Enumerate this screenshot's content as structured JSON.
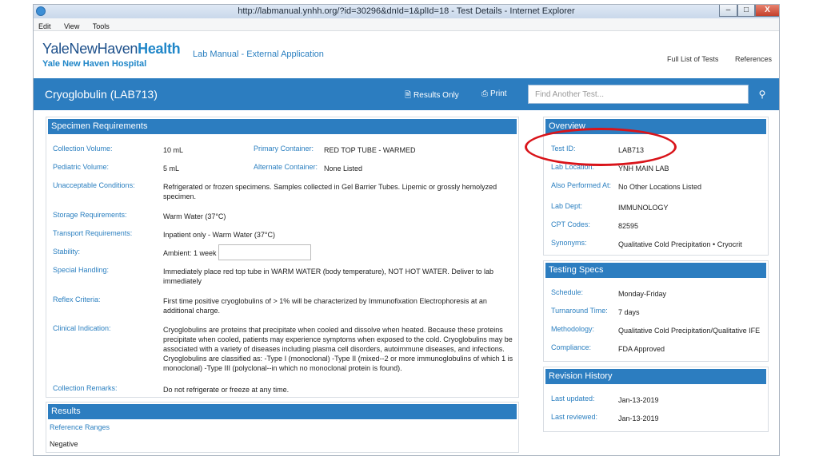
{
  "window": {
    "title": "http://labmanual.ynhh.org/?id=30296&dnId=1&plId=18 - Test Details - Internet Explorer",
    "min_label": "–",
    "max_label": "□",
    "close_label": "X"
  },
  "menu": [
    "Edit",
    "View",
    "Tools"
  ],
  "header": {
    "logo_main": "YaleNewHaven",
    "logo_accent": "Health",
    "logo_sub": "Yale New Haven Hospital",
    "app_name": "Lab Manual - External Application",
    "links": [
      "Full List of Tests",
      "References"
    ]
  },
  "bar": {
    "test_title": "Cryoglobulin (LAB713)",
    "results_only": "Results Only",
    "print": "Print",
    "search_placeholder": "Find Another Test..."
  },
  "specimen": {
    "heading": "Specimen Requirements",
    "collection_volume_label": "Collection Volume:",
    "collection_volume": "10  mL",
    "primary_container_label": "Primary Container:",
    "primary_container": "RED TOP TUBE - WARMED",
    "pediatric_volume_label": "Pediatric Volume:",
    "pediatric_volume": "5  mL",
    "alternate_container_label": "Alternate Container:",
    "alternate_container": "None Listed",
    "unacceptable_label": "Unacceptable Conditions:",
    "unacceptable": "Refrigerated or frozen specimens. Samples collected in Gel Barrier Tubes. Lipemic or grossly hemolyzed specimen.",
    "storage_label": "Storage Requirements:",
    "storage": "Warm Water (37°C)",
    "transport_label": "Transport Requirements:",
    "transport": "Inpatient only - Warm Water (37°C)",
    "stability_label": "Stability:",
    "stability": "Ambient: 1 week",
    "special_label": "Special Handling:",
    "special": "Immediately place red top tube in WARM WATER (body temperature), NOT HOT WATER. Deliver to lab immediately",
    "reflex_label": "Reflex Criteria:",
    "reflex": "First time positive cryoglobulins of > 1% will be characterized by Immunofixation Electrophoresis at an additional charge.",
    "clinical_label": "Clinical Indication:",
    "clinical": "Cryoglobulins are proteins that precipitate when cooled and dissolve when heated. Because these proteins precipitate when cooled, patients may experience symptoms when exposed to the cold. Cryoglobulins may be associated with a variety of diseases including plasma cell disorders, autoimmune diseases, and infections. Cryoglobulins are classified as: -Type I (monoclonal) -Type II (mixed--2 or more immunoglobulins of which 1 is monoclonal) -Type III (polyclonal--in which no monoclonal protein is found).",
    "remarks_label": "Collection Remarks:",
    "remarks": "Do not refrigerate or freeze at any time."
  },
  "results": {
    "heading": "Results",
    "reference_label": "Reference Ranges",
    "reference_value": "Negative"
  },
  "overview": {
    "heading": "Overview",
    "test_id_label": "Test ID:",
    "test_id": "LAB713",
    "lab_location_label": "Lab Location:",
    "lab_location": "YNH MAIN LAB",
    "also_performed_label": "Also Performed At:",
    "also_performed": "No Other Locations Listed",
    "lab_dept_label": "Lab Dept:",
    "lab_dept": "IMMUNOLOGY",
    "cpt_label": "CPT Codes:",
    "cpt": "82595",
    "synonyms_label": "Synonyms:",
    "synonyms": "Qualitative Cold Precipitation • Cryocrit"
  },
  "testing": {
    "heading": "Testing Specs",
    "schedule_label": "Schedule:",
    "schedule": "Monday-Friday",
    "turnaround_label": "Turnaround Time:",
    "turnaround": "7 days",
    "methodology_label": "Methodology:",
    "methodology": "Qualitative Cold Precipitation/Qualitative IFE",
    "compliance_label": "Compliance:",
    "compliance": "FDA Approved"
  },
  "revision": {
    "heading": "Revision History",
    "updated_label": "Last updated:",
    "updated": "Jan-13-2019",
    "reviewed_label": "Last reviewed:",
    "reviewed": "Jan-13-2019"
  },
  "colors": {
    "accent": "#2c7dc0",
    "annotation": "#d9141a"
  }
}
